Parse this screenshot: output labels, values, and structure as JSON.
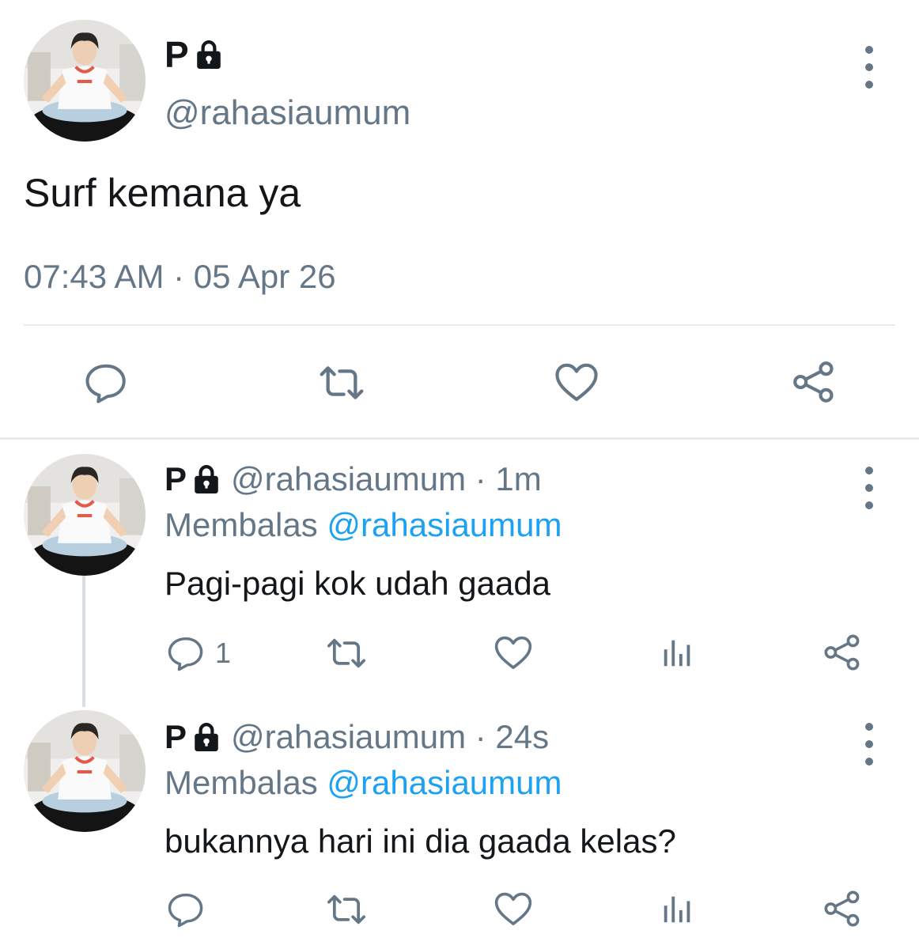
{
  "main_tweet": {
    "display_name": "P",
    "handle": "@rahasiaumum",
    "text": "Surf kemana ya",
    "timestamp": "07:43 AM · 05 Apr 26"
  },
  "replies": [
    {
      "display_name": "P",
      "handle_time": "@rahasiaumum · 1m",
      "replying_prefix": "Membalas",
      "replying_to": "@rahasiaumum",
      "text": "Pagi-pagi kok udah gaada",
      "reply_count": "1"
    },
    {
      "display_name": "P",
      "handle_time": "@rahasiaumum · 24s",
      "replying_prefix": "Membalas",
      "replying_to": "@rahasiaumum",
      "text": "bukannya hari ini dia gaada kelas?",
      "reply_count": ""
    }
  ],
  "icons": {
    "lock": "lock-icon",
    "more": "more-vertical-icon",
    "reply": "comment-bubble-icon",
    "retweet": "retweet-icon",
    "like": "heart-icon",
    "analytics": "bar-chart-icon",
    "share": "share-icon"
  },
  "colors": {
    "text": "#14171a",
    "secondary": "#657786",
    "link": "#1da1f2",
    "divider": "#e6ecf0"
  }
}
